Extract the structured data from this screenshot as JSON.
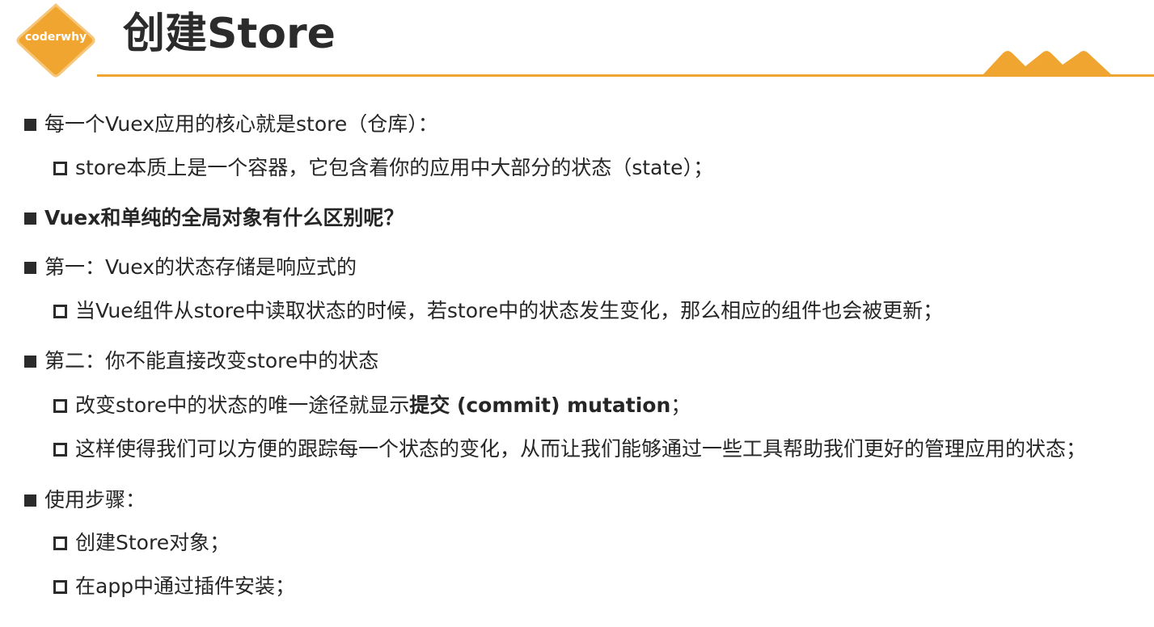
{
  "header": {
    "logo_text": "coderwhy",
    "title": "创建Store"
  },
  "colors": {
    "accent": "#f0a531",
    "text": "#262626"
  },
  "items": [
    {
      "level": 1,
      "text": "每一个Vuex应用的核心就是store（仓库）："
    },
    {
      "level": 2,
      "text": "store本质上是一个容器，它包含着你的应用中大部分的状态（state）；"
    },
    {
      "level": 1,
      "text": "Vuex和单纯的全局对象有什么区别呢？",
      "bold": true
    },
    {
      "level": 1,
      "text": "第一：Vuex的状态存储是响应式的"
    },
    {
      "level": 2,
      "text": "当Vue组件从store中读取状态的时候，若store中的状态发生变化，那么相应的组件也会被更新；"
    },
    {
      "level": 1,
      "text": "第二：你不能直接改变store中的状态"
    },
    {
      "level": 2,
      "text_before": "改变store中的状态的唯一途径就显示",
      "text_bold": "提交 (commit) mutation",
      "text_after": "；"
    },
    {
      "level": 2,
      "text": "这样使得我们可以方便的跟踪每一个状态的变化，从而让我们能够通过一些工具帮助我们更好的管理应用的状态；"
    },
    {
      "level": 1,
      "text": "使用步骤："
    },
    {
      "level": 2,
      "text": "创建Store对象；"
    },
    {
      "level": 2,
      "text": "在app中通过插件安装；"
    }
  ]
}
